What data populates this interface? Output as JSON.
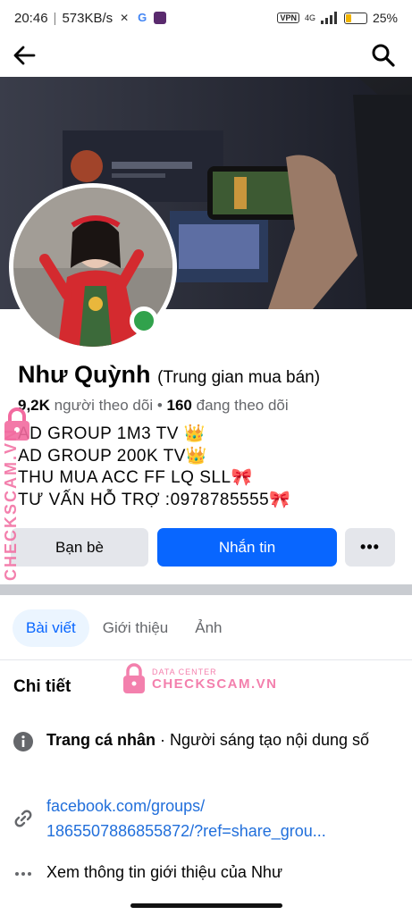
{
  "status_bar": {
    "time": "20:46",
    "speed": "573KB/s",
    "vpn": "VPN",
    "network": "4G",
    "battery": "25%",
    "battery_level": 0.25
  },
  "profile": {
    "name": "Như Quỳnh",
    "role": "(Trung gian mua bán)",
    "followers_count": "9,2K",
    "followers_label": "người theo dõi",
    "separator": "•",
    "following_count": "160",
    "following_label": "đang theo dõi",
    "bio": [
      "AD GROUP 1M3 TV 👑",
      "AD GROUP 200K TV👑",
      "THU MUA ACC FF LQ SLL🎀",
      "TƯ VẤN HỖ TRỢ :0978785555🎀"
    ],
    "online_color": "#31a24c"
  },
  "actions": {
    "friends": "Bạn bè",
    "message": "Nhắn tin",
    "more": "•••"
  },
  "tabs": [
    {
      "label": "Bài viết",
      "active": true
    },
    {
      "label": "Giới thiệu",
      "active": false
    },
    {
      "label": "Ảnh",
      "active": false
    }
  ],
  "details": {
    "title": "Chi tiết",
    "page_type_label": "Trang cá nhân",
    "page_type_sep": " · ",
    "page_type_value": "Người sáng tạo nội dung số",
    "link_line1": "facebook.com/groups/",
    "link_line2": "1865507886855872/?ref=share_grou...",
    "see_about": "Xem thông tin giới thiệu của Như"
  },
  "watermark": {
    "side_text": "CHECKSCAM.VN",
    "small": "DATA CENTER",
    "big": "CHECKSCAM.VN"
  },
  "colors": {
    "accent": "#0866ff",
    "link": "#216fdb",
    "watermark": "#f26a9f"
  }
}
